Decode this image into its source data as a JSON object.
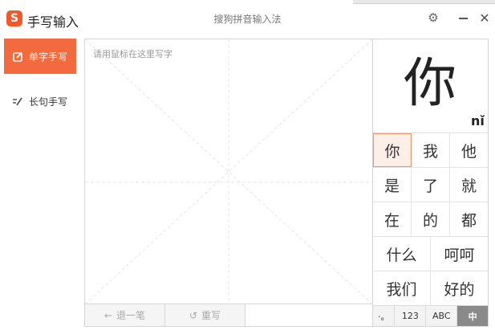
{
  "app": {
    "logo_letter": "S",
    "title": "手写输入",
    "window_title": "搜狗拼音输入法"
  },
  "controls": {
    "settings_icon": "⚙",
    "close_icon": "✕"
  },
  "sidebar": {
    "modes": [
      {
        "label": "单字手写",
        "icon": "pen-square-icon",
        "active": true
      },
      {
        "label": "长句手写",
        "icon": "sentence-pen-icon",
        "active": false
      }
    ]
  },
  "pad": {
    "hint": "请用鼠标在这里写字",
    "undo_label": "退一笔",
    "undo_icon": "←",
    "rewrite_label": "重写",
    "rewrite_icon": "↺"
  },
  "candidates": {
    "preview_char": "你",
    "preview_pinyin": "nǐ",
    "row1": [
      "你",
      "我",
      "他"
    ],
    "row2": [
      "是",
      "了",
      "就"
    ],
    "row3": [
      "在",
      "的",
      "都"
    ],
    "row4": [
      "什么",
      "呵呵"
    ],
    "row5": [
      "我们",
      "好的"
    ],
    "selected": "你"
  },
  "footer": {
    "punct": "·。",
    "numbers": "123",
    "letters": "ABC",
    "chinese": "中"
  },
  "colors": {
    "accent": "#f26a3d",
    "selected_bg": "#fdeee7",
    "active_footer": "#8a8a8a"
  }
}
